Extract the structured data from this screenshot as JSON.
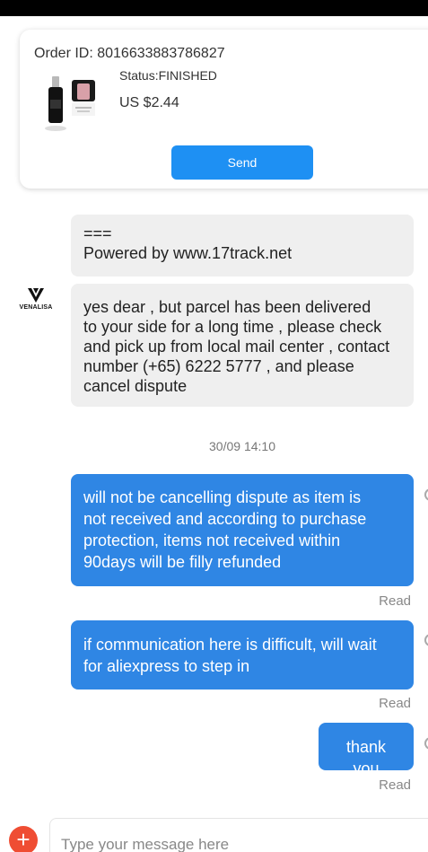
{
  "order": {
    "id_text": "Order ID: 8016633883786827",
    "status_text": "Status:FINISHED",
    "price_text": "US $2.44",
    "send_label": "Send"
  },
  "seller": {
    "logo_text": "VENALISA"
  },
  "messages": [
    {
      "direction": "in",
      "lines": [
        "===",
        "Powered by www.17track.net"
      ]
    },
    {
      "direction": "in",
      "lines": [
        "yes dear  , but parcel has been delivered",
        "to your side for a long time , please check",
        "and pick up from local mail center , contact",
        "number (+65) 6222 5777   , and please",
        "cancel dispute"
      ]
    },
    {
      "direction": "out",
      "lines": [
        "will not be cancelling dispute as item is",
        "not received and according to purchase",
        "protection, items not received within",
        "90days will be filly refunded"
      ],
      "receipt": "Read"
    },
    {
      "direction": "out",
      "lines": [
        "if communication here is difficult, will wait",
        "for aliexpress to step in"
      ],
      "receipt": "Read"
    },
    {
      "direction": "out",
      "lines": [
        "thank you"
      ],
      "receipt": "Read"
    }
  ],
  "timestamp": "30/09 14:10",
  "composer": {
    "placeholder": "Type your message here",
    "plus_icon": "+"
  },
  "colors": {
    "outgoing_bubble": "#2f86e4",
    "incoming_bubble": "#efefef",
    "send_button": "#1e90f3",
    "plus_button": "#ef4d33"
  }
}
